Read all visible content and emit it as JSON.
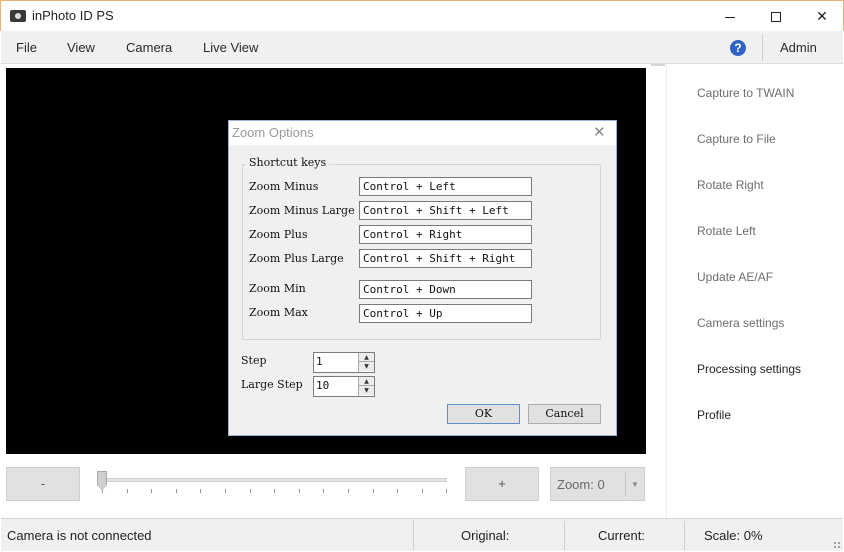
{
  "window": {
    "title": "inPhoto ID PS"
  },
  "menu": {
    "items": [
      "File",
      "View",
      "Camera",
      "Live View"
    ],
    "help_icon": "help-icon",
    "user": "Admin"
  },
  "actions": [
    {
      "label": "Capture to TWAIN",
      "enabled": false
    },
    {
      "label": "Capture to File",
      "enabled": false
    },
    {
      "label": "Rotate Right",
      "enabled": false
    },
    {
      "label": "Rotate Left",
      "enabled": false
    },
    {
      "label": "Update AE/AF",
      "enabled": false
    },
    {
      "label": "Camera settings",
      "enabled": false
    },
    {
      "label": "Processing settings",
      "enabled": true
    },
    {
      "label": "Profile",
      "enabled": true
    }
  ],
  "zoom_controls": {
    "minus": "-",
    "plus": "+",
    "zoom_label": "Zoom: 0",
    "slider_value": 0
  },
  "status": {
    "connection": "Camera is not connected",
    "original": "Original:",
    "current": "Current:",
    "scale": "Scale: 0%"
  },
  "dialog": {
    "title": "Zoom Options",
    "group_title": "Shortcut keys",
    "shortcuts": [
      {
        "label": "Zoom Minus",
        "value": "Control + Left"
      },
      {
        "label": "Zoom Minus Large",
        "value": "Control + Shift + Left"
      },
      {
        "label": "Zoom Plus",
        "value": "Control + Right"
      },
      {
        "label": "Zoom Plus Large",
        "value": "Control + Shift + Right"
      },
      {
        "label": "Zoom Min",
        "value": "Control + Down"
      },
      {
        "label": "Zoom Max",
        "value": "Control + Up"
      }
    ],
    "step_label": "Step",
    "step_value": "1",
    "large_step_label": "Large Step",
    "large_step_value": "10",
    "ok": "OK",
    "cancel": "Cancel"
  }
}
